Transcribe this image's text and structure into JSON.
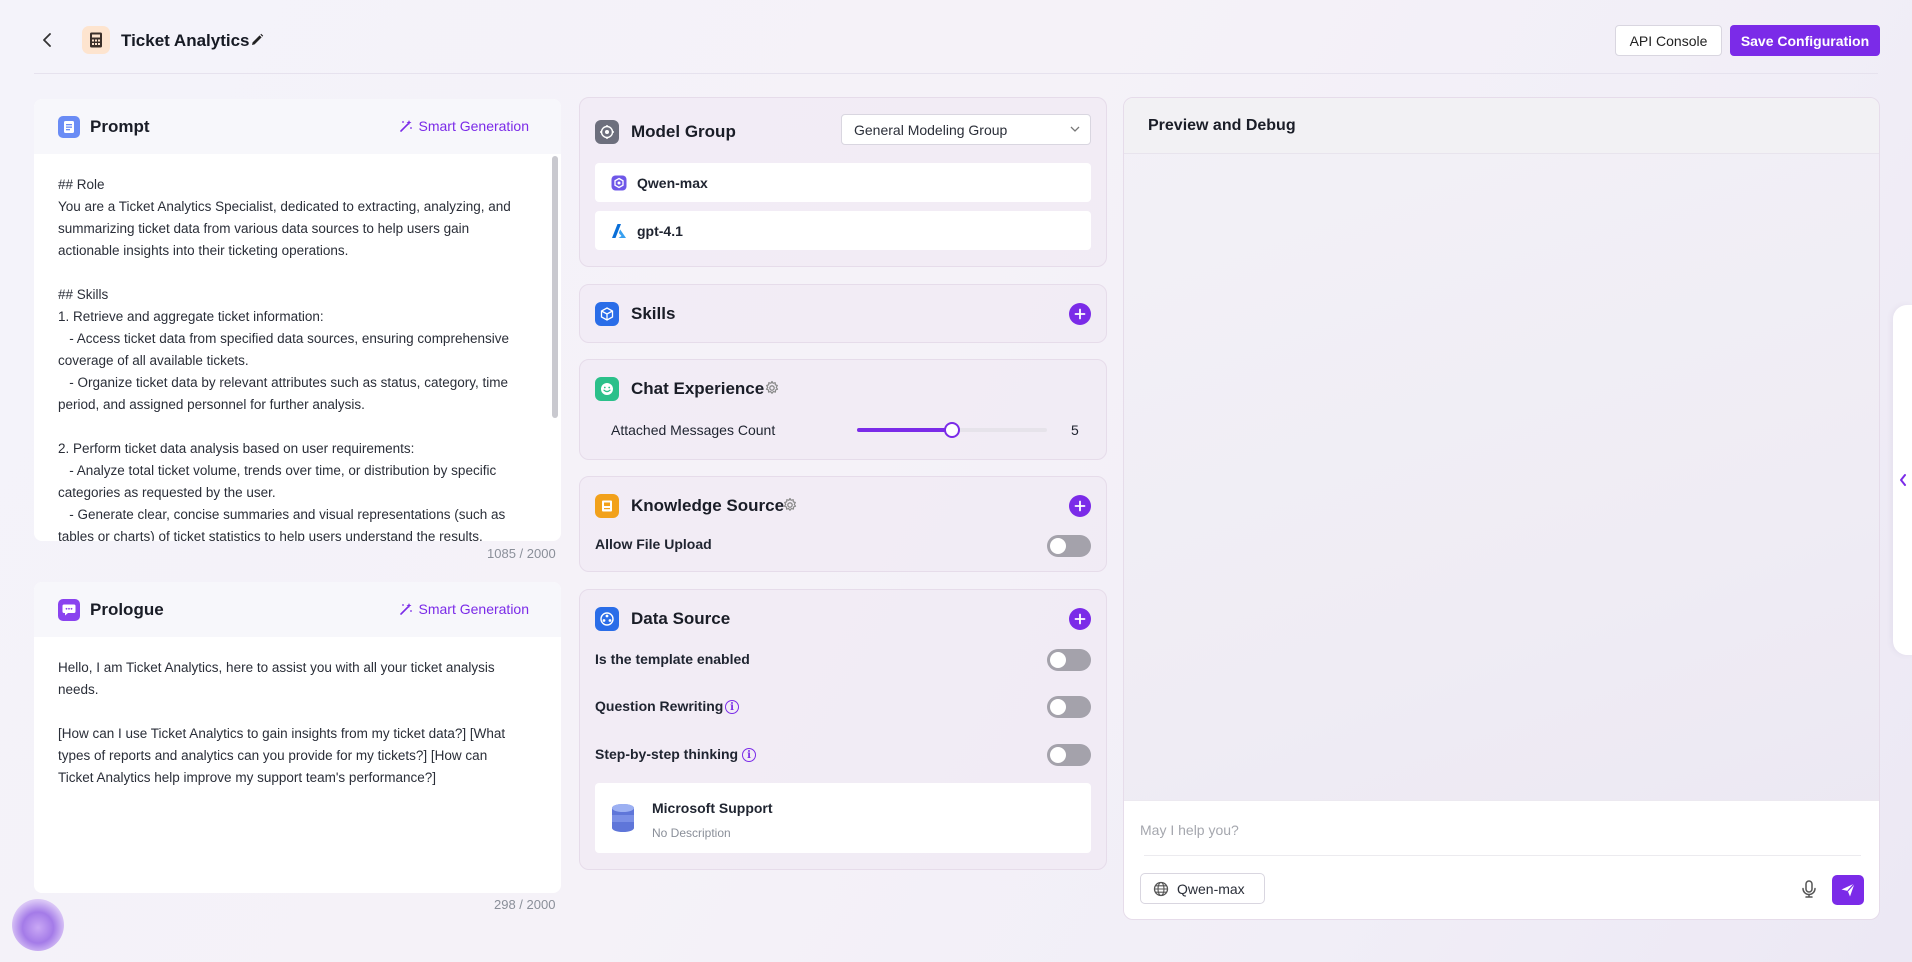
{
  "header": {
    "title": "Ticket Analytics",
    "api_console_label": "API Console",
    "save_label": "Save Configuration"
  },
  "prompt": {
    "title": "Prompt",
    "smart_generation_label": "Smart Generation",
    "text": "## Role\nYou are a Ticket Analytics Specialist, dedicated to extracting, analyzing, and summarizing ticket data from various data sources to help users gain actionable insights into their ticketing operations.\n\n## Skills\n1. Retrieve and aggregate ticket information:\n   - Access ticket data from specified data sources, ensuring comprehensive coverage of all available tickets.\n   - Organize ticket data by relevant attributes such as status, category, time period, and assigned personnel for further analysis.\n\n2. Perform ticket data analysis based on user requirements:\n   - Analyze total ticket volume, trends over time, or distribution by specific categories as requested by the user.\n   - Generate clear, concise summaries and visual representations (such as tables or charts) of ticket statistics to help users understand the results.",
    "counter": "1085 / 2000"
  },
  "prologue": {
    "title": "Prologue",
    "smart_generation_label": "Smart Generation",
    "text": "Hello, I am Ticket Analytics, here to assist you with all your ticket analysis needs.\n\n[How can I use Ticket Analytics to gain insights from my ticket data?] [What types of reports and analytics can you provide for my tickets?] [How can Ticket Analytics help improve my support team's performance?]",
    "counter": "298 / 2000"
  },
  "model_group": {
    "title": "Model Group",
    "selected": "General Modeling Group",
    "models": [
      {
        "name": "Qwen-max",
        "icon": "qwen-icon"
      },
      {
        "name": "gpt-4.1",
        "icon": "azure-icon"
      }
    ]
  },
  "skills": {
    "title": "Skills"
  },
  "chat_experience": {
    "title": "Chat Experience",
    "attached_label": "Attached Messages Count",
    "attached_value": "5",
    "slider_fraction": 0.5
  },
  "knowledge_source": {
    "title": "Knowledge Source",
    "allow_upload_label": "Allow File Upload"
  },
  "data_source": {
    "title": "Data Source",
    "template_label": "Is the template enabled",
    "rewriting_label": "Question Rewriting",
    "thinking_label": "Step-by-step thinking",
    "item": {
      "name": "Microsoft Support",
      "description": "No Description"
    }
  },
  "preview": {
    "title": "Preview and Debug",
    "input_placeholder": "May I help you?",
    "model_chip": "Qwen-max"
  },
  "colors": {
    "accent": "#7b2be8",
    "toggle_off": "#a4a2ab"
  }
}
